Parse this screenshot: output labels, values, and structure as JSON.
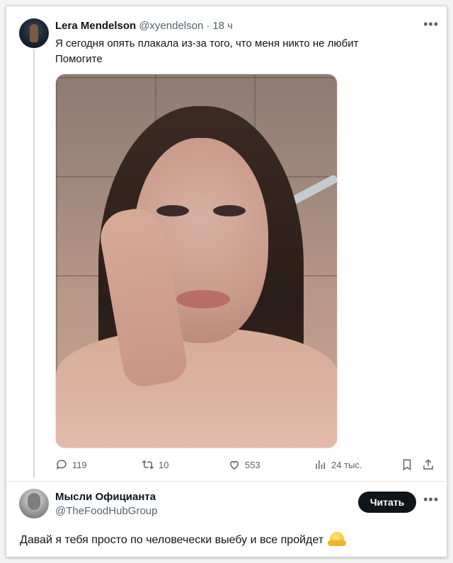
{
  "tweet": {
    "author_name": "Lera Mendelson",
    "author_handle": "@xyendelson",
    "separator": "·",
    "time": "18 ч",
    "more_icon": "more-horizontal-icon",
    "text_line1": "Я сегодня опять плакала из-за того, что меня никто не любит",
    "text_line2": "Помогите",
    "media_alt": "photo",
    "actions": {
      "reply": {
        "icon": "reply-icon",
        "count": "119"
      },
      "retweet": {
        "icon": "retweet-icon",
        "count": "10"
      },
      "like": {
        "icon": "heart-icon",
        "count": "553"
      },
      "views": {
        "icon": "views-icon",
        "count": "24 тыс."
      },
      "bookmark": {
        "icon": "bookmark-icon"
      },
      "share": {
        "icon": "share-icon"
      }
    }
  },
  "reply": {
    "author_name": "Мысли Официанта",
    "author_handle": "@TheFoodHubGroup",
    "follow_label": "Читать",
    "more_icon": "more-horizontal-icon",
    "text": "Давай я тебя просто по человечески выебу и все пройдет",
    "emoji": "hugging-face-emoji"
  },
  "colors": {
    "text": "#0f1419",
    "secondary": "#536471",
    "thread_line": "#cfd9de",
    "button_bg": "#0f1419"
  }
}
